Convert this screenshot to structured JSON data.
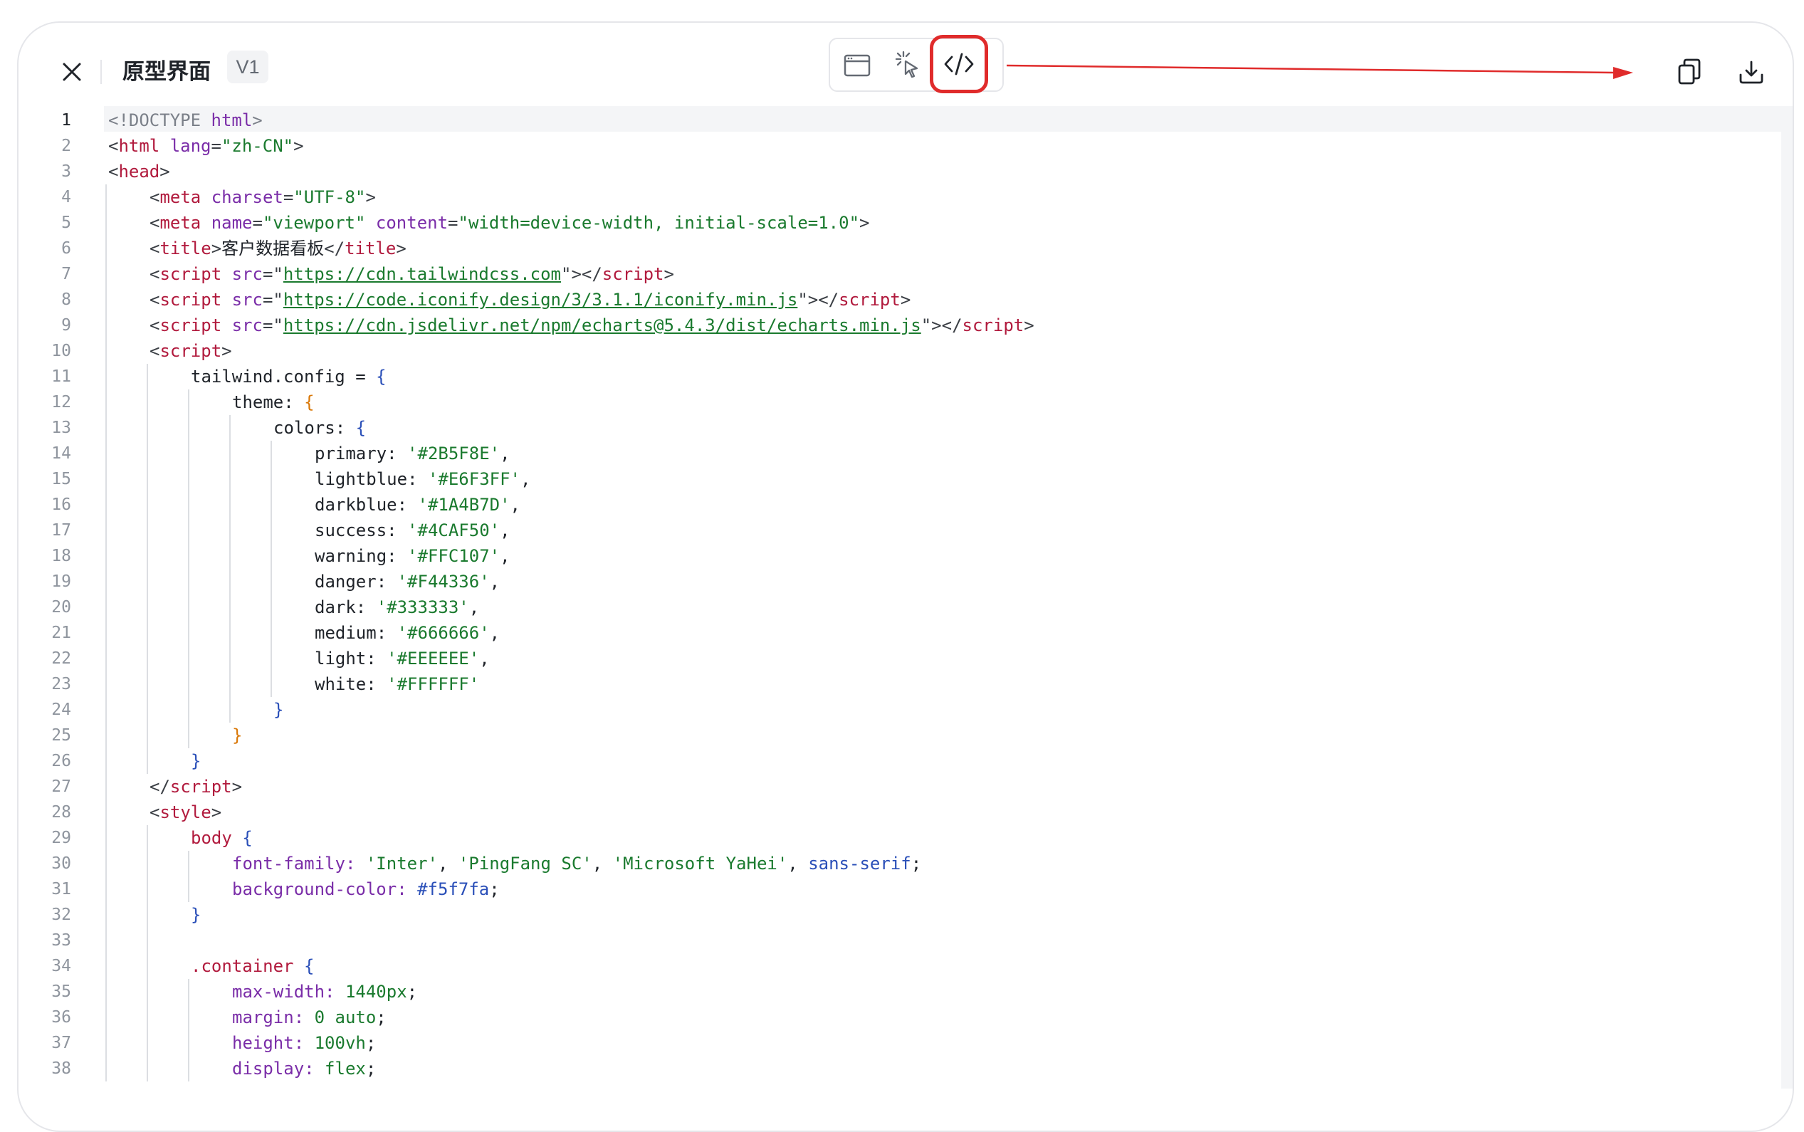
{
  "header": {
    "title": "原型界面",
    "version": "V1"
  },
  "icons": {
    "close": "close-icon",
    "preview": "browser-window-icon",
    "inspect": "cursor-click-icon",
    "code": "code-icon",
    "copy": "copy-icon",
    "download": "download-icon"
  },
  "colors": {
    "active_outline": "#e02b2b",
    "annotation_arrow": "#e02b2b"
  },
  "editor": {
    "current_line": 1,
    "lines": [
      {
        "n": "1",
        "indent": 0,
        "tokens": [
          [
            "doc",
            "<!DOCTYPE "
          ],
          [
            "attr",
            "html"
          ],
          [
            "doc",
            ">"
          ]
        ]
      },
      {
        "n": "2",
        "indent": 0,
        "tokens": [
          [
            "punc",
            "<"
          ],
          [
            "tag",
            "html"
          ],
          [
            "attr",
            " lang"
          ],
          [
            "punc",
            "="
          ],
          [
            "str",
            "\"zh-CN\""
          ],
          [
            "punc",
            ">"
          ]
        ]
      },
      {
        "n": "3",
        "indent": 0,
        "tokens": [
          [
            "punc",
            "<"
          ],
          [
            "tag",
            "head"
          ],
          [
            "punc",
            ">"
          ]
        ]
      },
      {
        "n": "4",
        "indent": 1,
        "tokens": [
          [
            "punc",
            "<"
          ],
          [
            "tag",
            "meta"
          ],
          [
            "attr",
            " charset"
          ],
          [
            "punc",
            "="
          ],
          [
            "str",
            "\"UTF-8\""
          ],
          [
            "punc",
            ">"
          ]
        ]
      },
      {
        "n": "5",
        "indent": 1,
        "tokens": [
          [
            "punc",
            "<"
          ],
          [
            "tag",
            "meta"
          ],
          [
            "attr",
            " name"
          ],
          [
            "punc",
            "="
          ],
          [
            "str",
            "\"viewport\""
          ],
          [
            "attr",
            " content"
          ],
          [
            "punc",
            "="
          ],
          [
            "str",
            "\"width=device-width, initial-scale=1.0\""
          ],
          [
            "punc",
            ">"
          ]
        ]
      },
      {
        "n": "6",
        "indent": 1,
        "tokens": [
          [
            "punc",
            "<"
          ],
          [
            "tag",
            "title"
          ],
          [
            "punc",
            ">"
          ],
          [
            "id",
            "客户数据看板"
          ],
          [
            "punc",
            "</"
          ],
          [
            "tag",
            "title"
          ],
          [
            "punc",
            ">"
          ]
        ]
      },
      {
        "n": "7",
        "indent": 1,
        "tokens": [
          [
            "punc",
            "<"
          ],
          [
            "tag",
            "script"
          ],
          [
            "attr",
            " src"
          ],
          [
            "punc",
            "=\""
          ],
          [
            "link",
            "https://cdn.tailwindcss.com"
          ],
          [
            "punc",
            "\"></"
          ],
          [
            "tag",
            "script"
          ],
          [
            "punc",
            ">"
          ]
        ]
      },
      {
        "n": "8",
        "indent": 1,
        "tokens": [
          [
            "punc",
            "<"
          ],
          [
            "tag",
            "script"
          ],
          [
            "attr",
            " src"
          ],
          [
            "punc",
            "=\""
          ],
          [
            "link",
            "https://code.iconify.design/3/3.1.1/iconify.min.js"
          ],
          [
            "punc",
            "\"></"
          ],
          [
            "tag",
            "script"
          ],
          [
            "punc",
            ">"
          ]
        ]
      },
      {
        "n": "9",
        "indent": 1,
        "tokens": [
          [
            "punc",
            "<"
          ],
          [
            "tag",
            "script"
          ],
          [
            "attr",
            " src"
          ],
          [
            "punc",
            "=\""
          ],
          [
            "link",
            "https://cdn.jsdelivr.net/npm/echarts@5.4.3/dist/echarts.min.js"
          ],
          [
            "punc",
            "\"></"
          ],
          [
            "tag",
            "script"
          ],
          [
            "punc",
            ">"
          ]
        ]
      },
      {
        "n": "10",
        "indent": 1,
        "tokens": [
          [
            "punc",
            "<"
          ],
          [
            "tag",
            "script"
          ],
          [
            "punc",
            ">"
          ]
        ]
      },
      {
        "n": "11",
        "indent": 2,
        "tokens": [
          [
            "id",
            "tailwind.config = "
          ],
          [
            "brace",
            "{"
          ]
        ]
      },
      {
        "n": "12",
        "indent": 3,
        "tokens": [
          [
            "id",
            "theme: "
          ],
          [
            "brace2",
            "{"
          ]
        ]
      },
      {
        "n": "13",
        "indent": 4,
        "tokens": [
          [
            "id",
            "colors: "
          ],
          [
            "brace",
            "{"
          ]
        ]
      },
      {
        "n": "14",
        "indent": 5,
        "tokens": [
          [
            "id",
            "primary: "
          ],
          [
            "str",
            "'#2B5F8E'"
          ],
          [
            "id",
            ","
          ]
        ]
      },
      {
        "n": "15",
        "indent": 5,
        "tokens": [
          [
            "id",
            "lightblue: "
          ],
          [
            "str",
            "'#E6F3FF'"
          ],
          [
            "id",
            ","
          ]
        ]
      },
      {
        "n": "16",
        "indent": 5,
        "tokens": [
          [
            "id",
            "darkblue: "
          ],
          [
            "str",
            "'#1A4B7D'"
          ],
          [
            "id",
            ","
          ]
        ]
      },
      {
        "n": "17",
        "indent": 5,
        "tokens": [
          [
            "id",
            "success: "
          ],
          [
            "str",
            "'#4CAF50'"
          ],
          [
            "id",
            ","
          ]
        ]
      },
      {
        "n": "18",
        "indent": 5,
        "tokens": [
          [
            "id",
            "warning: "
          ],
          [
            "str",
            "'#FFC107'"
          ],
          [
            "id",
            ","
          ]
        ]
      },
      {
        "n": "19",
        "indent": 5,
        "tokens": [
          [
            "id",
            "danger: "
          ],
          [
            "str",
            "'#F44336'"
          ],
          [
            "id",
            ","
          ]
        ]
      },
      {
        "n": "20",
        "indent": 5,
        "tokens": [
          [
            "id",
            "dark: "
          ],
          [
            "str",
            "'#333333'"
          ],
          [
            "id",
            ","
          ]
        ]
      },
      {
        "n": "21",
        "indent": 5,
        "tokens": [
          [
            "id",
            "medium: "
          ],
          [
            "str",
            "'#666666'"
          ],
          [
            "id",
            ","
          ]
        ]
      },
      {
        "n": "22",
        "indent": 5,
        "tokens": [
          [
            "id",
            "light: "
          ],
          [
            "str",
            "'#EEEEEE'"
          ],
          [
            "id",
            ","
          ]
        ]
      },
      {
        "n": "23",
        "indent": 5,
        "tokens": [
          [
            "id",
            "white: "
          ],
          [
            "str",
            "'#FFFFFF'"
          ]
        ]
      },
      {
        "n": "24",
        "indent": 4,
        "tokens": [
          [
            "brace",
            "}"
          ]
        ]
      },
      {
        "n": "25",
        "indent": 3,
        "tokens": [
          [
            "brace2",
            "}"
          ]
        ]
      },
      {
        "n": "26",
        "indent": 2,
        "tokens": [
          [
            "brace",
            "}"
          ]
        ]
      },
      {
        "n": "27",
        "indent": 1,
        "tokens": [
          [
            "punc",
            "</"
          ],
          [
            "tag",
            "script"
          ],
          [
            "punc",
            ">"
          ]
        ]
      },
      {
        "n": "28",
        "indent": 1,
        "tokens": [
          [
            "punc",
            "<"
          ],
          [
            "tag",
            "style"
          ],
          [
            "punc",
            ">"
          ]
        ]
      },
      {
        "n": "29",
        "indent": 2,
        "tokens": [
          [
            "sel",
            "body "
          ],
          [
            "brace",
            "{"
          ]
        ]
      },
      {
        "n": "30",
        "indent": 3,
        "tokens": [
          [
            "prop",
            "font-family: "
          ],
          [
            "val",
            "'Inter'"
          ],
          [
            "id",
            ", "
          ],
          [
            "val",
            "'PingFang SC'"
          ],
          [
            "id",
            ", "
          ],
          [
            "val",
            "'Microsoft YaHei'"
          ],
          [
            "id",
            ", "
          ],
          [
            "kw",
            "sans-serif"
          ],
          [
            "id",
            ";"
          ]
        ]
      },
      {
        "n": "31",
        "indent": 3,
        "tokens": [
          [
            "prop",
            "background-color: "
          ],
          [
            "kw",
            "#f5f7fa"
          ],
          [
            "id",
            ";"
          ]
        ]
      },
      {
        "n": "32",
        "indent": 2,
        "tokens": [
          [
            "brace",
            "}"
          ]
        ]
      },
      {
        "n": "33",
        "indent": 0,
        "tokens": []
      },
      {
        "n": "34",
        "indent": 2,
        "tokens": [
          [
            "sel",
            ".container "
          ],
          [
            "brace",
            "{"
          ]
        ]
      },
      {
        "n": "35",
        "indent": 3,
        "tokens": [
          [
            "prop",
            "max-width: "
          ],
          [
            "val",
            "1440px"
          ],
          [
            "id",
            ";"
          ]
        ]
      },
      {
        "n": "36",
        "indent": 3,
        "tokens": [
          [
            "prop",
            "margin: "
          ],
          [
            "val",
            "0 auto"
          ],
          [
            "id",
            ";"
          ]
        ]
      },
      {
        "n": "37",
        "indent": 3,
        "tokens": [
          [
            "prop",
            "height: "
          ],
          [
            "val",
            "100vh"
          ],
          [
            "id",
            ";"
          ]
        ]
      },
      {
        "n": "38",
        "indent": 3,
        "tokens": [
          [
            "prop",
            "display: "
          ],
          [
            "val",
            "flex"
          ],
          [
            "id",
            ";"
          ]
        ]
      }
    ]
  }
}
